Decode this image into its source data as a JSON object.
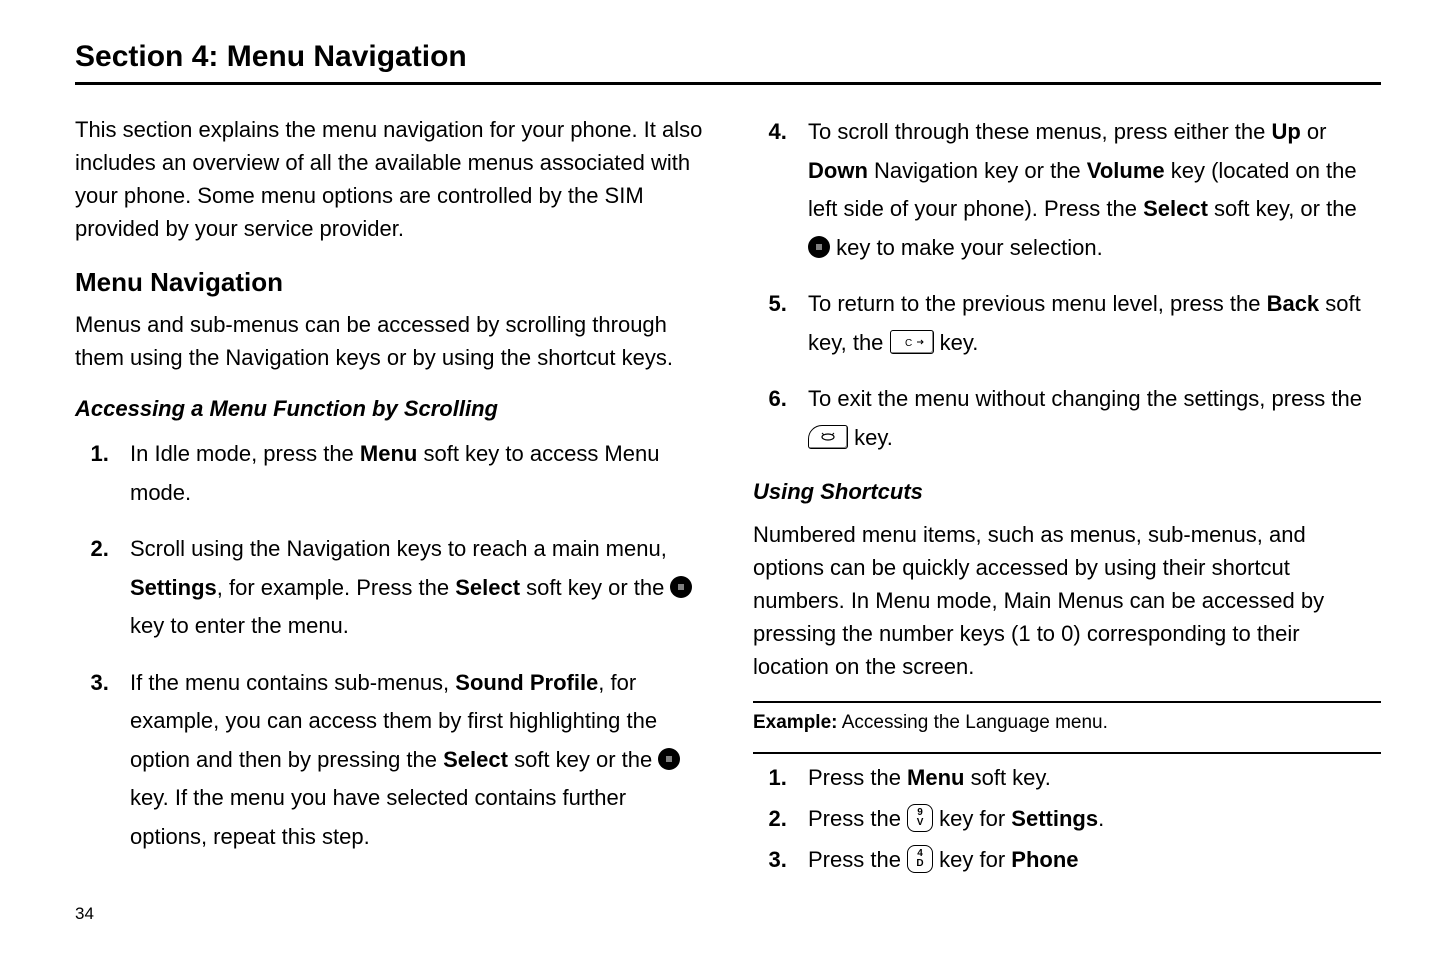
{
  "title": "Section 4: Menu Navigation",
  "intro": "This section explains the menu navigation for your phone. It also includes an overview of all the available menus associated with your phone. Some menu options are controlled by the SIM provided by your service provider.",
  "h2_menu_nav": "Menu Navigation",
  "menu_nav_body": "Menus and sub-menus can be accessed by scrolling through them using the Navigation keys or by using the shortcut keys.",
  "h3_accessing": "Accessing a Menu Function by Scrolling",
  "left_steps": {
    "s1_a": "In Idle mode, press the ",
    "s1_b": "Menu",
    "s1_c": " soft key to access Menu mode.",
    "s2_a": "Scroll using the Navigation keys to reach a main menu, ",
    "s2_b": "Settings",
    "s2_c": ", for example. Press the ",
    "s2_d": "Select",
    "s2_e": " soft key or the ",
    "s2_f": " key to enter the menu.",
    "s3_a": "If the menu contains sub-menus, ",
    "s3_b": "Sound Profile",
    "s3_c": ", for example, you can access them by first highlighting the option and then by pressing the ",
    "s3_d": "Select",
    "s3_e": " soft key or the ",
    "s3_f": " key. If the menu you have selected contains further options, repeat this step."
  },
  "right_steps": {
    "s4_a": "To scroll through these menus, press either the ",
    "s4_b": "Up",
    "s4_c": " or ",
    "s4_d": "Down",
    "s4_e": " Navigation key or the ",
    "s4_f": "Volume",
    "s4_g": " key (located on the left side of your phone). Press the ",
    "s4_h": "Select",
    "s4_i": " soft key, or the ",
    "s4_j": " key to make your selection.",
    "s5_a": "To return to the previous menu level, press the ",
    "s5_b": "Back",
    "s5_c": " soft key, the ",
    "s5_d": " key.",
    "s6_a": "To exit the menu without changing the settings, press the ",
    "s6_b": " key."
  },
  "h3_shortcuts": "Using Shortcuts",
  "shortcuts_body": "Numbered menu items, such as menus, sub-menus, and options can be quickly accessed by using their shortcut numbers. In Menu mode, Main Menus can be accessed by pressing the number keys (1 to 0) corresponding to their location on the screen.",
  "example_label": "Example:",
  "example_text": "  Accessing the Language menu.",
  "ex_steps": {
    "s1_a": "Press the ",
    "s1_b": "Menu",
    "s1_c": " soft key.",
    "s2_a": "Press the ",
    "s2_b": " key for ",
    "s2_c": "Settings",
    "s2_d": ".",
    "s3_a": "Press the ",
    "s3_b": " key for ",
    "s3_c": "Phone"
  },
  "page_num": "34",
  "key_labels": {
    "c_key": "c",
    "end_key": "end",
    "num9_top": "9",
    "num9_bot": "V",
    "num4_top": "4",
    "num4_bot": "D"
  }
}
